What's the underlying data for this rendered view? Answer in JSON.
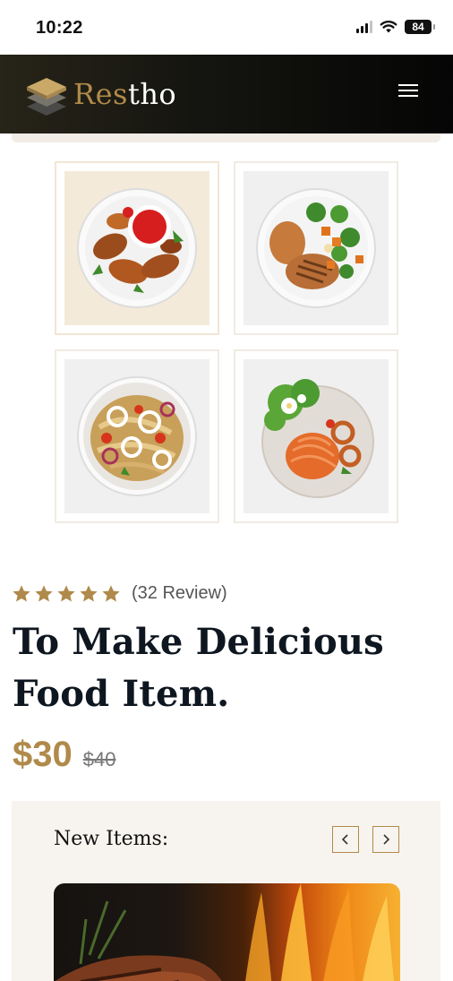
{
  "status_bar": {
    "time": "10:22",
    "battery": "84"
  },
  "header": {
    "logo_part1": "Res",
    "logo_part2": "tho",
    "menu_icon": "hamburger-icon"
  },
  "gallery": {
    "thumbnails": [
      {
        "icon": "grilled-chicken-dish-icon"
      },
      {
        "icon": "chicken-vegetables-dish-icon"
      },
      {
        "icon": "pasta-salad-dish-icon"
      },
      {
        "icon": "spaghetti-dish-icon"
      }
    ]
  },
  "product": {
    "rating": 5,
    "review_text": "(32 Review)",
    "title": "To Make Delicious Food Item.",
    "price": "$30",
    "old_price": "$40"
  },
  "new_items": {
    "title": "New Items:",
    "prev_icon": "chevron-left-icon",
    "next_icon": "chevron-right-icon"
  },
  "colors": {
    "accent": "#b08a4a",
    "header_bg": "#141410",
    "title": "#0e1620",
    "section_bg": "#f7f4ef"
  }
}
